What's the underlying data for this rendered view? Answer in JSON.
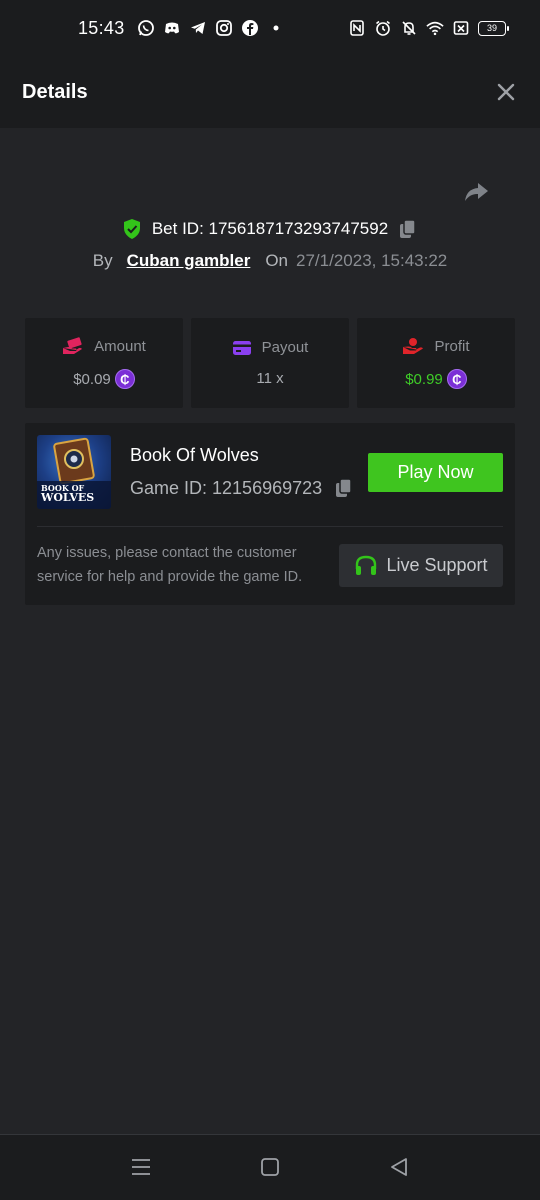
{
  "status_bar": {
    "time": "15:43",
    "battery": "39",
    "left_icons": [
      "whatsapp-icon",
      "discord-icon",
      "telegram-icon",
      "instagram-icon",
      "facebook-icon",
      "dot-icon"
    ],
    "right_icons": [
      "nfc-icon",
      "alarm-icon",
      "mute-icon",
      "wifi-icon",
      "sim-off-icon",
      "battery-icon"
    ]
  },
  "header": {
    "title": "Details",
    "close_icon": "close-icon"
  },
  "bet": {
    "id_label": "Bet ID: 1756187173293747592",
    "by_label": "By",
    "user": "Cuban gambler",
    "on_label": "On",
    "date": "27/1/2023, 15:43:22"
  },
  "stats": [
    {
      "label": "Amount",
      "value": "$0.09",
      "icon": "money-hand-icon",
      "icon_color": "#e0245e",
      "coin": true,
      "value_color": "#a8abb0"
    },
    {
      "label": "Payout",
      "value": "11 x",
      "icon": "card-icon",
      "icon_color": "#8a3ff0",
      "coin": false,
      "value_color": "#a8abb0"
    },
    {
      "label": "Profit",
      "value": "$0.99",
      "icon": "profit-hand-icon",
      "icon_color": "#e0242a",
      "coin": true,
      "value_color": "#3fcc28"
    }
  ],
  "coin_symbol": "₵",
  "game": {
    "name": "Book Of Wolves",
    "id_label": "Game ID: 12156969723",
    "play_label": "Play Now",
    "thumb_text": [
      "BOOK OF",
      "WOLVES"
    ]
  },
  "support": {
    "text": "Any issues, please contact the customer service for help and provide the game ID.",
    "button_label": "Live Support"
  },
  "colors": {
    "accent_green": "#3fc51f",
    "background": "#232427",
    "panel": "#1b1c1e"
  }
}
